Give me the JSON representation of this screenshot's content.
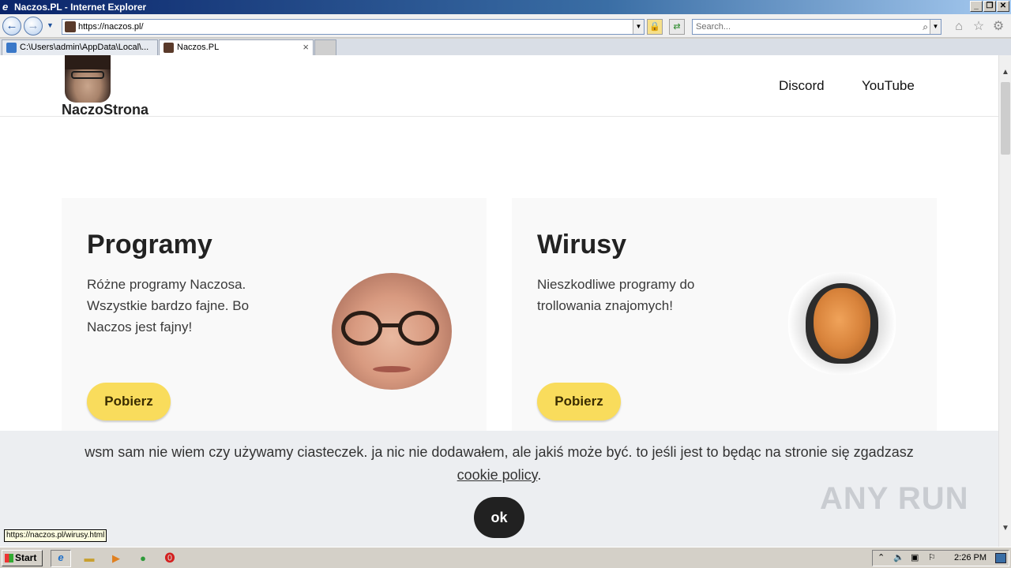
{
  "window": {
    "title": "Naczos.PL - Internet Explorer",
    "minimize": "_",
    "restore": "❐",
    "close": "✕"
  },
  "browser": {
    "address": "https://naczos.pl/",
    "search_placeholder": "Search...",
    "tabs": [
      {
        "label": "C:\\Users\\admin\\AppData\\Local\\...",
        "active": false
      },
      {
        "label": "Naczos.PL",
        "active": true
      }
    ],
    "tab_close": "×",
    "status_url": "https://naczos.pl/wirusy.html"
  },
  "site": {
    "name": "NaczoStrona",
    "nav": [
      "Discord",
      "YouTube"
    ],
    "cards": [
      {
        "title": "Programy",
        "text": "Różne programy Naczosa. Wszystkie bardzo fajne. Bo Naczos jest fajny!",
        "button": "Pobierz"
      },
      {
        "title": "Wirusy",
        "text": "Nieszkodliwe programy do trollowania znajomych!",
        "button": "Pobierz"
      }
    ],
    "cookie": {
      "text": "wsm sam nie wiem czy używamy ciasteczek. ja nic nie dodawałem, ale jakiś może być. to jeśli jest to będąc na stronie się zgadzasz",
      "link": "cookie policy",
      "suffix": ".",
      "ok": "ok"
    },
    "watermark": "ANY RUN"
  },
  "taskbar": {
    "start": "Start",
    "clock": "2:26 PM"
  },
  "colors": {
    "button_yellow": "#f9dc5c",
    "ok_button": "#212121",
    "cookie_bg": "#eceef1",
    "card_bg": "#f9f9f9"
  }
}
